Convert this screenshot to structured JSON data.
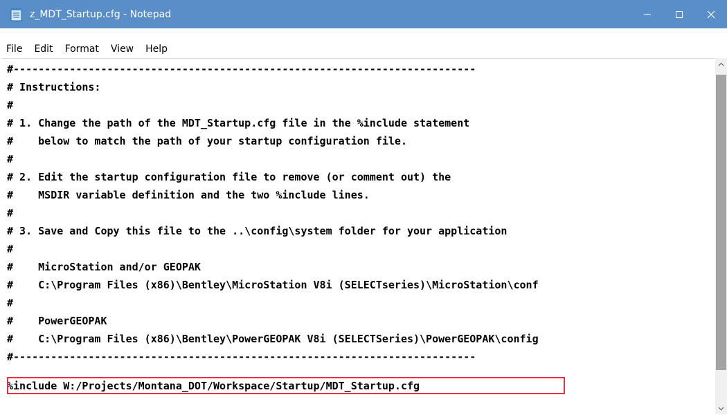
{
  "window": {
    "title": "z_MDT_Startup.cfg - Notepad",
    "accent_color": "#5a8ec8",
    "controls": {
      "minimize_icon": "minimize-icon",
      "maximize_icon": "maximize-icon",
      "close_icon": "close-icon"
    }
  },
  "menu": {
    "items": [
      "File",
      "Edit",
      "Format",
      "View",
      "Help"
    ]
  },
  "editor": {
    "lines": [
      "#--------------------------------------------------------------------------",
      "# Instructions:",
      "#",
      "# 1. Change the path of the MDT_Startup.cfg file in the %include statement",
      "#    below to match the path of your startup configuration file.",
      "#",
      "# 2. Edit the startup configuration file to remove (or comment out) the",
      "#    MSDIR variable definition and the two %include lines.",
      "#",
      "# 3. Save and Copy this file to the ..\\config\\system folder for your application",
      "#",
      "#    MicroStation and/or GEOPAK",
      "#    C:\\Program Files (x86)\\Bentley\\MicroStation V8i (SELECTseries)\\MicroStation\\conf",
      "#",
      "#    PowerGEOPAK",
      "#    C:\\Program Files (x86)\\Bentley\\PowerGEOPAK V8i (SELECTSeries)\\PowerGEOPAK\\config",
      "#--------------------------------------------------------------------------",
      "",
      "%include W:/Projects/Montana_DOT/Workspace/Startup/MDT_Startup.cfg"
    ],
    "highlight_color": "#e8303f"
  }
}
